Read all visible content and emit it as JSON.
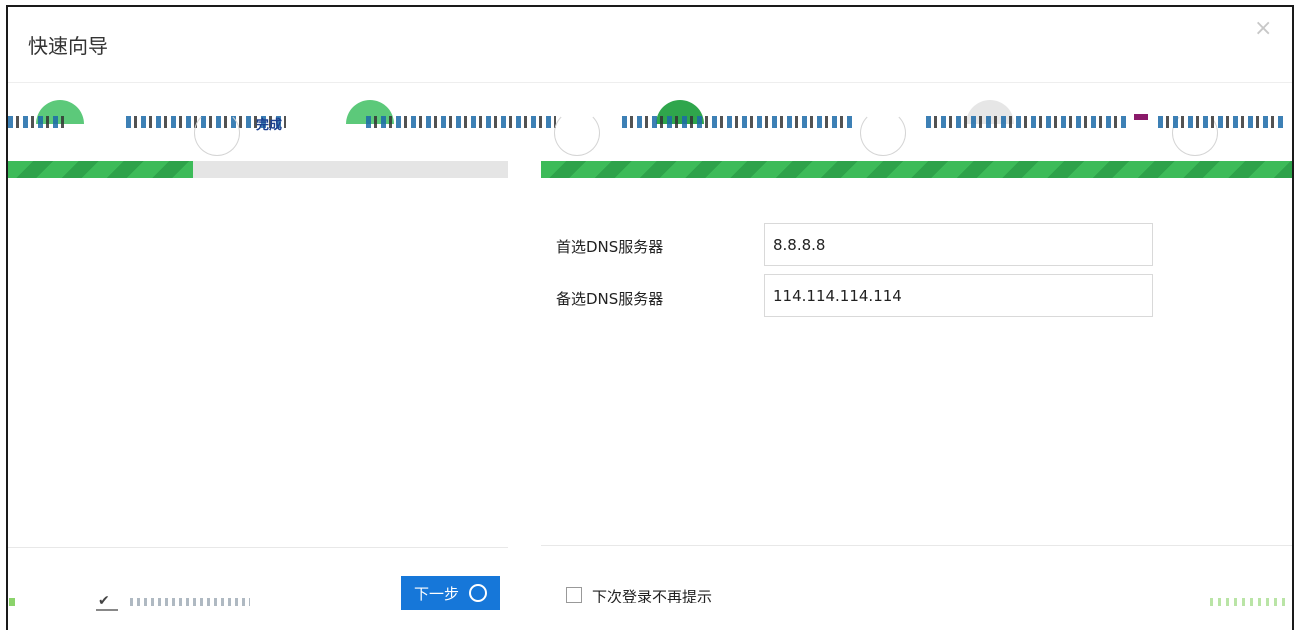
{
  "dialog": {
    "title": "快速向导",
    "close_icon": "×"
  },
  "stepper": {
    "visible_label": "完成",
    "colors": {
      "done": "#5cc97a",
      "active": "#2fa64c",
      "pending": "#e6e6e6"
    }
  },
  "progress": {
    "left_fraction": 0.37,
    "right_fraction": 1.0,
    "fill_color": "#3dbb59"
  },
  "form": {
    "primary_dns_label": "首选DNS服务器",
    "primary_dns_value": "8.8.8.8",
    "secondary_dns_label": "备选DNS服务器",
    "secondary_dns_value": "114.114.114.114"
  },
  "footer": {
    "next_label": "下一步",
    "check_icon": "✔",
    "dont_show_label": "下次登录不再提示"
  }
}
